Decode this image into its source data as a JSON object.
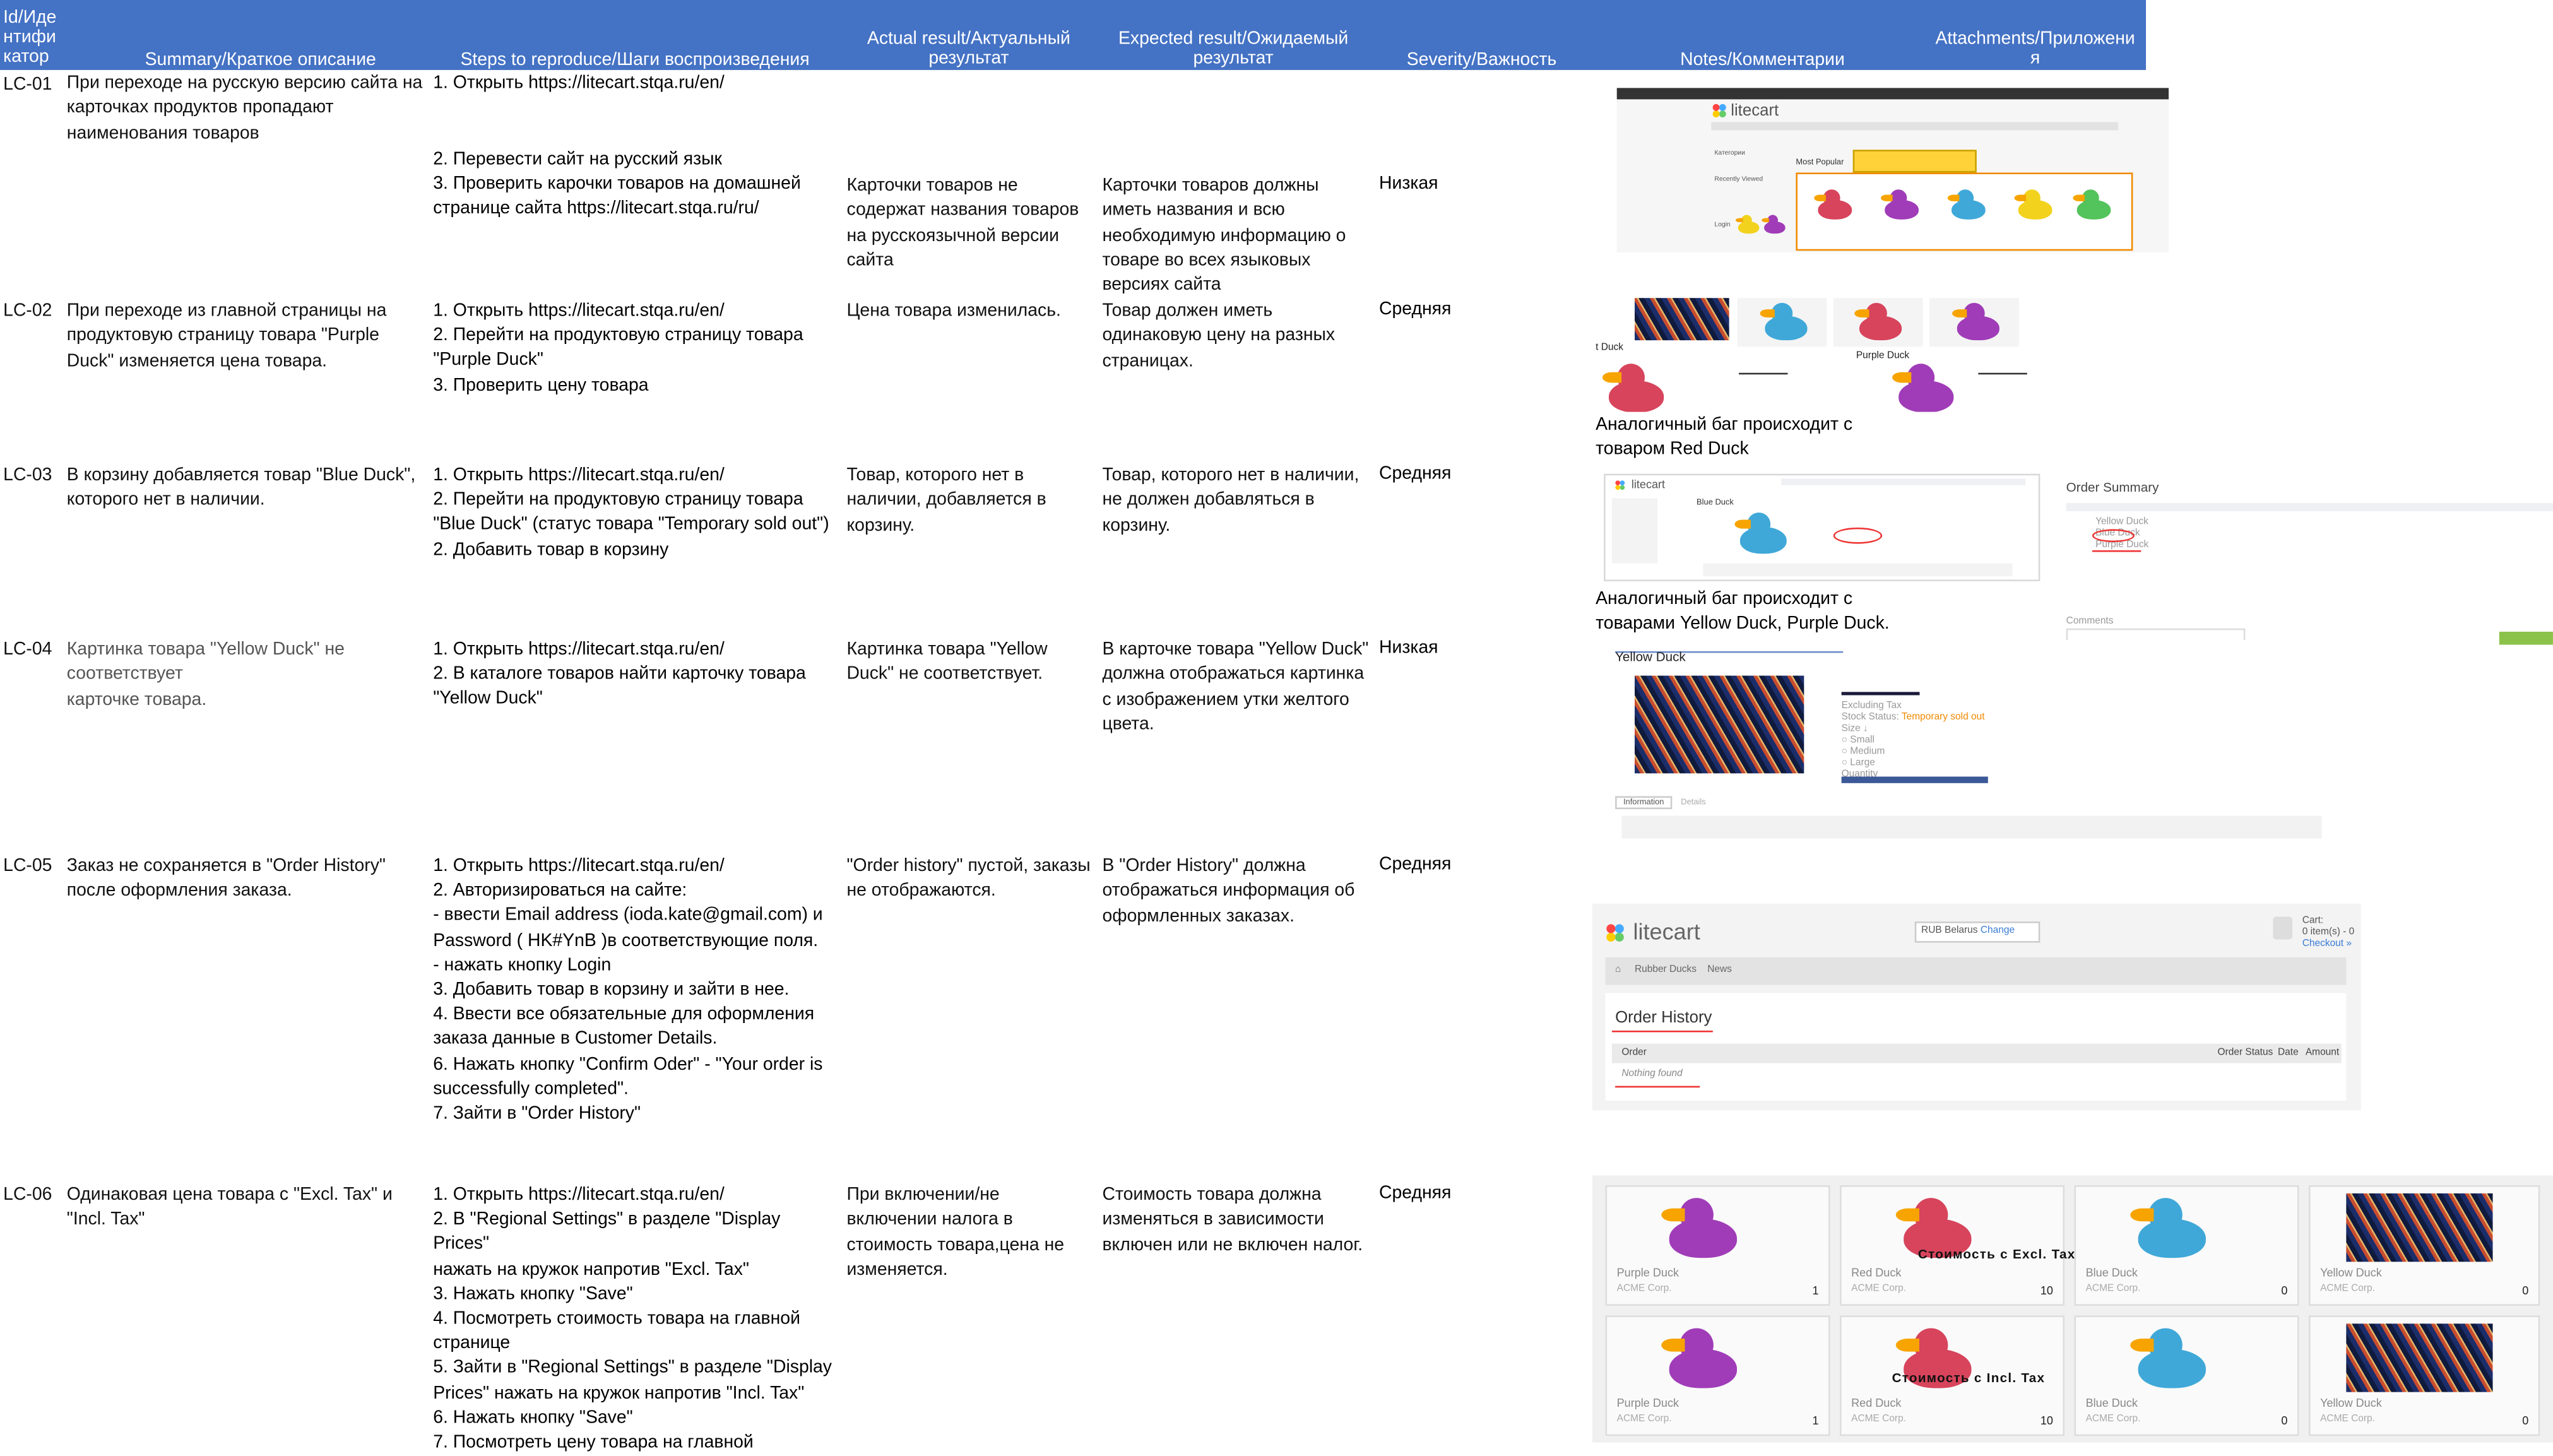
{
  "header": {
    "id": [
      "Id/Иде",
      "нтифи",
      "катор"
    ],
    "summary": "Summary/Краткое описание",
    "steps": "Steps to reproduce/Шаги воспроизведения",
    "actual": [
      "Actual result/Актуальный",
      "результат"
    ],
    "expected": [
      "Expected result/Ожидаемый",
      "результат"
    ],
    "severity": "Severity/Важность",
    "notes": "Notes/Комментарии",
    "attachments": [
      "Attachments/Приложени",
      "я"
    ]
  },
  "rows": [
    {
      "id": "LC-01",
      "summary": [
        "При переходе на русскую версию сайта на",
        "карточках продуктов пропадают",
        "наименования товаров"
      ],
      "steps_a": [
        "1. Открыть https://litecart.stqa.ru/en/"
      ],
      "steps_b": [
        "2. Перевести сайт на русский язык",
        "3. Проверить карочки товаров на домашней",
        "странице сайта https://litecart.stqa.ru/ru/"
      ],
      "actual": [
        "Карточки товаров не",
        "содержат названия товаров",
        "на русскоязычной версии",
        "сайта"
      ],
      "expected": [
        "Карточки товаров должны",
        "иметь названия и всю",
        "необходимую информацию о",
        "товаре во всех языковых",
        "версиях сайта"
      ],
      "severity": "Низкая"
    },
    {
      "id": "LC-02",
      "summary": [
        "При переходе из главной страницы на",
        "продуктовую страницу товара \"Purple",
        "Duck\" изменяется цена товара."
      ],
      "steps": [
        "1. Открыть https://litecart.stqa.ru/en/",
        "2. Перейти на продуктовую страницу товара",
        "\"Purple Duck\"",
        "3. Проверить цену товара"
      ],
      "actual": [
        "Цена товара изменилась."
      ],
      "expected": [
        "Товар должен иметь",
        "одинаковую цену на разных",
        "страницах."
      ],
      "severity": "Средняя",
      "note": [
        "Аналогичный баг происходит с",
        "товаром Red Duck"
      ]
    },
    {
      "id": "LC-03",
      "summary": [
        "В корзину добавляется товар \"Blue Duck\",",
        "которого нет в наличии."
      ],
      "steps": [
        "1. Открыть https://litecart.stqa.ru/en/",
        "2. Перейти на продуктовую страницу товара",
        "\"Blue Duck\" (статус товара \"Temporary sold out\")",
        "2. Добавить товар в корзину"
      ],
      "actual": [
        "Товар, которого нет в",
        "наличии, добавляется в",
        "корзину."
      ],
      "expected": [
        "Товар, которого нет в наличии,",
        "не должен добавляться в",
        "корзину."
      ],
      "severity": "Средняя",
      "note": [
        "Аналогичный баг происходит с",
        "товарами Yellow Duck, Purple Duck."
      ]
    },
    {
      "id": "LC-04",
      "summary": [
        "Картинка товара \"Yellow Duck\" не",
        "соответствует",
        "карточке товара."
      ],
      "steps": [
        "1. Открыть https://litecart.stqa.ru/en/",
        "2. В каталоге товаров найти карточку товара",
        "\"Yellow Duck\""
      ],
      "actual": [
        "Картинка товара \"Yellow",
        "Duck\" не соответствует."
      ],
      "expected": [
        "В карточке товара \"Yellow Duck\"",
        "должна отображаться картинка",
        "с  изображением утки желтого",
        "цвета."
      ],
      "severity": "Низкая"
    },
    {
      "id": "LC-05",
      "summary": [
        "Заказ не сохраняется в \"Order History\"",
        "после оформления заказа."
      ],
      "steps": [
        "1. Открыть https://litecart.stqa.ru/en/",
        "2. Авторизироваться на сайте:",
        "- ввести Email address  (ioda.kate@gmail.com) и",
        "Password ( HK#YnB )в соответствующие поля.",
        "- нажать кнопку Login",
        "3. Добавить товар в корзину и зайти в нее.",
        "4. Ввести все обязательные для оформления",
        "заказа данные в Customer Details.",
        "6. Нажать кнопку \"Confirm Oder\"  - \"Your order is",
        "successfully completed\".",
        "7. Зайти в \"Order History\""
      ],
      "actual": [
        "\"Order history\" пустой, заказы",
        "не отображаются."
      ],
      "expected": [
        "В \"Order History\" должна",
        "отображаться информация об",
        "оформленных заказах."
      ],
      "severity": "Средняя"
    },
    {
      "id": "LC-06",
      "summary": [
        "Одинаковая цена товара с \"Excl. Tax\" и",
        "\"Incl. Tax\""
      ],
      "steps": [
        "1. Открыть https://litecart.stqa.ru/en/",
        "2. В \"Regional Settings\" в разделе \"Display Prices\"",
        "нажать на кружок напротив \"Excl. Tax\"",
        "3. Нажать кнопку \"Save\"",
        "4. Посмотреть стоимость товара на главной",
        "странице",
        "5. Зайти в \"Regional Settings\" в разделе \"Display",
        "Prices\" нажать на кружок напротив \"Incl. Tax\"",
        "6. Нажать кнопку \"Save\"",
        "7. Посмотреть цену товара на главной"
      ],
      "actual": [
        "При включении/не",
        "включении налога в",
        "стоимость товара,цена не",
        "изменяется."
      ],
      "expected": [
        "Стоимость товара должна",
        "изменяться в зависимости",
        "включен или не включен налог."
      ],
      "severity": "Средняя"
    }
  ],
  "attachments": {
    "shot1": {
      "logo": "litecart",
      "section": "Most Popular",
      "sidebar": [
        "Категории",
        "Recently Viewed",
        "Login"
      ]
    },
    "shot2": {
      "label_purple": "Purple Duck",
      "label_duck": "t Duck"
    },
    "shot3": {
      "logo": "litecart",
      "panel_title": "Order Summary",
      "item": "Blue Duck",
      "comments": "Comments"
    },
    "shot4": {
      "title": "Yellow Duck",
      "tabs": [
        "Information",
        "Details"
      ]
    },
    "shot5": {
      "logo": "litecart",
      "region": "RUB  Belarus",
      "change": "Change",
      "cart": "Cart:",
      "cart_items": "0 item(s) - 0",
      "checkout": "Checkout »",
      "nav": [
        "Rubber Ducks",
        "News"
      ],
      "title": "Order History",
      "cols": [
        "Order",
        "Order Status",
        "Date",
        "Amount"
      ],
      "empty": "Nothing found"
    },
    "shot6": {
      "overlay_excl": "Стоимость с Excl. Tax",
      "overlay_incl": "Стоимость с Incl. Tax",
      "vendor": "ACME Corp.",
      "cards": [
        {
          "name": "Purple Duck",
          "qty": "1"
        },
        {
          "name": "Red Duck",
          "qty": "10"
        },
        {
          "name": "Blue Duck",
          "qty": "0"
        },
        {
          "name": "Yellow Duck",
          "qty": "0"
        }
      ]
    }
  }
}
